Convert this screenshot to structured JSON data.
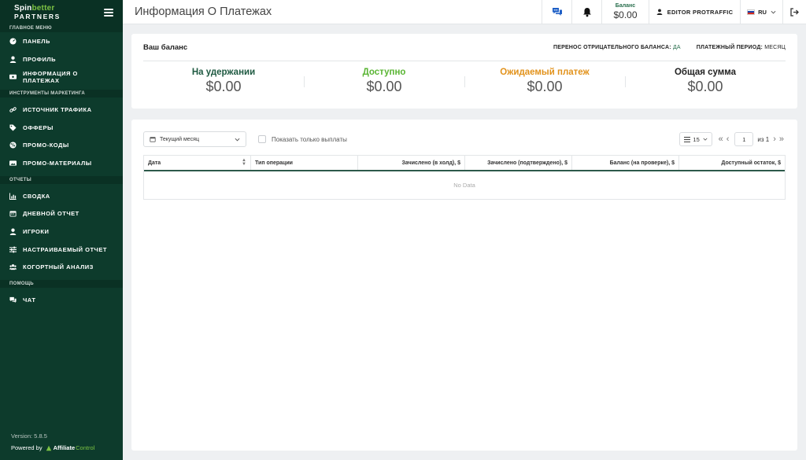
{
  "sidebar": {
    "logo_spin": "Spin",
    "logo_better": "better",
    "logo_partners": "PARTNERS",
    "sections": [
      {
        "title": "ГЛАВНОЕ МЕНЮ",
        "items": [
          {
            "label": "ПАНЕЛЬ",
            "icon": "dashboard-icon"
          },
          {
            "label": "ПРОФИЛЬ",
            "icon": "user-icon"
          },
          {
            "label": "ИНФОРМАЦИЯ О ПЛАТЕЖАХ",
            "icon": "payments-icon"
          }
        ]
      },
      {
        "title": "ИНСТРУМЕНТЫ МАРКЕТИНГА",
        "items": [
          {
            "label": "ИСТОЧНИК ТРАФИКА",
            "icon": "link-icon"
          },
          {
            "label": "ОФФЕРЫ",
            "icon": "tag-icon"
          },
          {
            "label": "ПРОМО-КОДЫ",
            "icon": "promo-icon"
          },
          {
            "label": "ПРОМО-МАТЕРИАЛЫ",
            "icon": "images-icon"
          }
        ]
      },
      {
        "title": "ОТЧЕТЫ",
        "items": [
          {
            "label": "СВОДКА",
            "icon": "chart-icon"
          },
          {
            "label": "ДНЕВНОЙ ОТЧЕТ",
            "icon": "calendar-icon"
          },
          {
            "label": "ИГРОКИ",
            "icon": "player-icon"
          },
          {
            "label": "НАСТРАИВАЕМЫЙ ОТЧЕТ",
            "icon": "sliders-icon"
          },
          {
            "label": "КОГОРТНЫЙ АНАЛИЗ",
            "icon": "users-icon"
          }
        ]
      },
      {
        "title": "ПОМОЩЬ",
        "items": [
          {
            "label": "ЧАТ",
            "icon": "chat-icon"
          }
        ]
      }
    ],
    "version": "Version: 5.8.5",
    "powered_by": "Powered by",
    "brand_affiliate": "Affiliate",
    "brand_control": "Control"
  },
  "header": {
    "title": "Информация О Платежах",
    "balance_label": "Баланс",
    "balance_value": "$0.00",
    "user_name": "EDITOR PROTRAFFIC",
    "language": "RU"
  },
  "balance_card": {
    "title": "Ваш баланс",
    "negative_carryover_label": "ПЕРЕНОС ОТРИЦАТЕЛЬНОГО БАЛАНСА:",
    "negative_carryover_value": "ДА",
    "payment_period_label": "ПЛАТЕЖНЫЙ ПЕРИОД:",
    "payment_period_value": "МЕСЯЦ",
    "columns": [
      {
        "label": "На удержании",
        "value": "$0.00",
        "color": "#1f5a42"
      },
      {
        "label": "Доступно",
        "value": "$0.00",
        "color": "#5ab534"
      },
      {
        "label": "Ожидаемый платеж",
        "value": "$0.00",
        "color": "#e2921b"
      },
      {
        "label": "Общая сумма",
        "value": "$0.00",
        "color": "#222222"
      }
    ]
  },
  "table_card": {
    "period_select": "Текущий месяц",
    "only_payouts_label": "Показать только выплаты",
    "page_size": "15",
    "current_page": "1",
    "of_pages": "из 1",
    "columns": [
      "Дата",
      "Тип операции",
      "Зачислено (в холд), $",
      "Зачислено (подтверждено), $",
      "Баланс (на проверке), $",
      "Доступный остаток, $"
    ],
    "empty_text": "No Data"
  },
  "colors": {
    "sidebar_bg": "#0d3b2c",
    "accent_green": "#2a6f4e",
    "available_green": "#5ab534",
    "expected_orange": "#e2921b"
  }
}
